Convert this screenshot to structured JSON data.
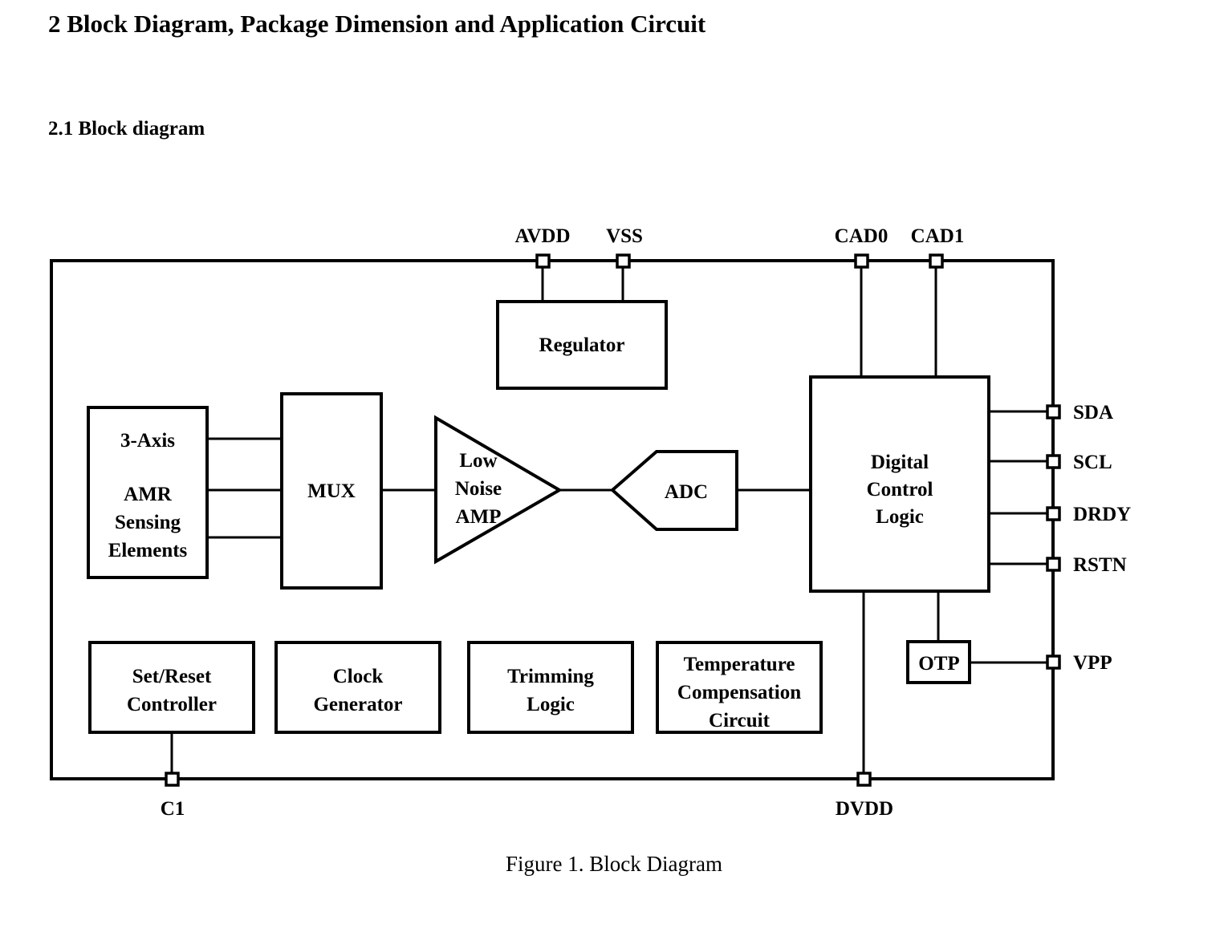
{
  "document": {
    "heading": "2 Block Diagram, Package Dimension and Application Circuit",
    "subheading": "2.1 Block diagram",
    "caption": "Figure 1. Block Diagram"
  },
  "diagram": {
    "title": "Block Diagram",
    "blocks": {
      "amr": {
        "line1": "3-Axis",
        "line2": "AMR",
        "line3": "Sensing",
        "line4": "Elements"
      },
      "mux": {
        "label": "MUX"
      },
      "amp": {
        "line1": "Low",
        "line2": "Noise",
        "line3": "AMP"
      },
      "adc": {
        "label": "ADC"
      },
      "regulator": {
        "label": "Regulator"
      },
      "digital_control": {
        "line1": "Digital",
        "line2": "Control",
        "line3": "Logic"
      },
      "otp": {
        "label": "OTP"
      },
      "set_reset": {
        "line1": "Set/Reset",
        "line2": "Controller"
      },
      "clock": {
        "line1": "Clock",
        "line2": "Generator"
      },
      "trimming": {
        "line1": "Trimming",
        "line2": "Logic"
      },
      "temp_comp": {
        "line1": "Temperature",
        "line2": "Compensation",
        "line3": "Circuit"
      }
    },
    "pins": {
      "top": [
        "AVDD",
        "VSS",
        "CAD0",
        "CAD1"
      ],
      "right": [
        "SDA",
        "SCL",
        "DRDY",
        "RSTN",
        "VPP"
      ],
      "bottom": [
        "C1",
        "DVDD"
      ]
    },
    "colors": {
      "line": "#000000",
      "fill": "#ffffff",
      "text": "#000000"
    }
  }
}
